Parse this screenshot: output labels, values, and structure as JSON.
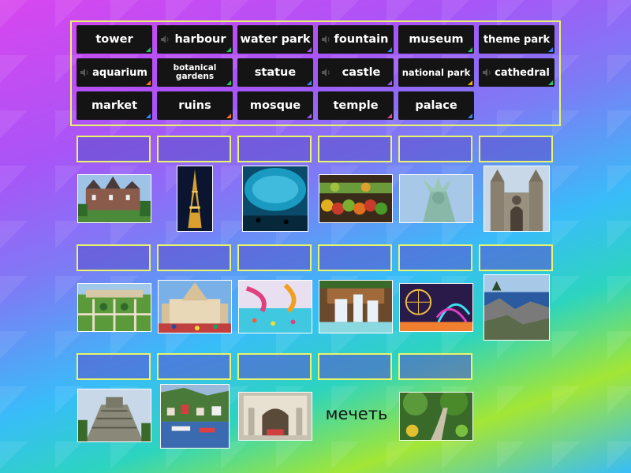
{
  "activity": "match up",
  "word_bank": [
    {
      "label": "tower",
      "audio": false,
      "corner_color": "#22c55e"
    },
    {
      "label": "harbour",
      "audio": true,
      "corner_color": "#22c55e"
    },
    {
      "label": "water park",
      "audio": false,
      "corner_color": "#a855f7"
    },
    {
      "label": "fountain",
      "audio": true,
      "corner_color": "#3b82f6"
    },
    {
      "label": "museum",
      "audio": false,
      "corner_color": "#22c55e"
    },
    {
      "label": "theme park",
      "audio": false,
      "corner_color": "#3b82f6"
    },
    {
      "label": "aquarium",
      "audio": true,
      "corner_color": "#f97316"
    },
    {
      "label": "botanical gardens",
      "audio": false,
      "corner_color": "#22c55e"
    },
    {
      "label": "statue",
      "audio": false,
      "corner_color": "#3b82f6"
    },
    {
      "label": "castle",
      "audio": true,
      "corner_color": "#a855f7"
    },
    {
      "label": "national park",
      "audio": false,
      "corner_color": "#eab308"
    },
    {
      "label": "cathedral",
      "audio": true,
      "corner_color": "#22c55e"
    },
    {
      "label": "market",
      "audio": false,
      "corner_color": "#3b82f6"
    },
    {
      "label": "ruins",
      "audio": false,
      "corner_color": "#f97316"
    },
    {
      "label": "mosque",
      "audio": false,
      "corner_color": "#a855f7"
    },
    {
      "label": "temple",
      "audio": false,
      "corner_color": "#ec4899"
    },
    {
      "label": "palace",
      "audio": false,
      "corner_color": "#3b82f6"
    }
  ],
  "rows": [
    {
      "slots": 6,
      "images": [
        "castle-photo",
        "eiffel-tower-photo",
        "aquarium-photo",
        "market-photo",
        "statue-of-liberty-photo",
        "cathedral-photo"
      ]
    },
    {
      "slots": 6,
      "images": [
        "botanical-gardens-photo",
        "temple-photo",
        "water-park-photo",
        "fountain-photo",
        "theme-park-photo",
        "national-park-photo"
      ]
    },
    {
      "slots": 5,
      "images": [
        "ruins-photo",
        "harbour-photo",
        "museum-photo",
        "text-clue",
        "palace-garden-photo"
      ]
    }
  ],
  "text_clue": "мечеть",
  "colors": {
    "slot_border": "#e9f56a",
    "tile_bg": "#141414"
  }
}
